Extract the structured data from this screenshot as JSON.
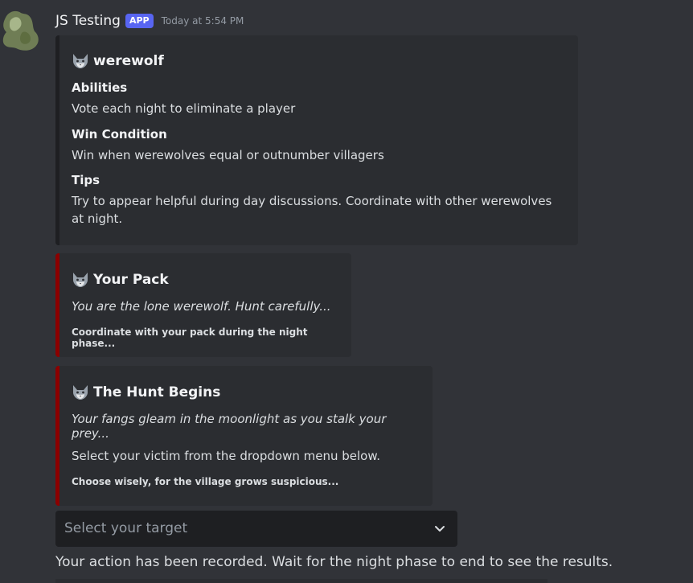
{
  "message": {
    "author": "JS Testing",
    "badge": "APP",
    "timestamp": "Today at 5:54 PM",
    "avatar_icon": "wolf-silhouette-avatar"
  },
  "colors": {
    "background": "#313338",
    "embed_background": "#2b2d31",
    "embed1_bar": "#1e1f22",
    "embed_red_bar": "#8b0000",
    "badge": "#5865f2",
    "select_background": "#1e1f22"
  },
  "embeds": [
    {
      "title_icon": "wolf-emoji-icon",
      "title": "werewolf",
      "fields": [
        {
          "name": "Abilities",
          "value": "Vote each night to eliminate a player"
        },
        {
          "name": "Win Condition",
          "value": "Win when werewolves equal or outnumber villagers"
        },
        {
          "name": "Tips",
          "value": "Try to appear helpful during day discussions. Coordinate with other werewolves at night."
        }
      ]
    },
    {
      "title_icon": "wolf-emoji-icon",
      "title": "Your Pack",
      "description": "You are the lone werewolf. Hunt carefully...",
      "footer": "Coordinate with your pack during the night phase..."
    },
    {
      "title_icon": "wolf-emoji-icon",
      "title": "The Hunt Begins",
      "description": "Your fangs gleam in the moonlight as you stalk your prey...",
      "text": "Select your victim from the dropdown menu below.",
      "footer": "Choose wisely, for the village grows suspicious..."
    }
  ],
  "select": {
    "placeholder": "Select your target",
    "icon": "chevron-down-icon"
  },
  "result": "Your action has been recorded. Wait for the night phase to end to see the results."
}
